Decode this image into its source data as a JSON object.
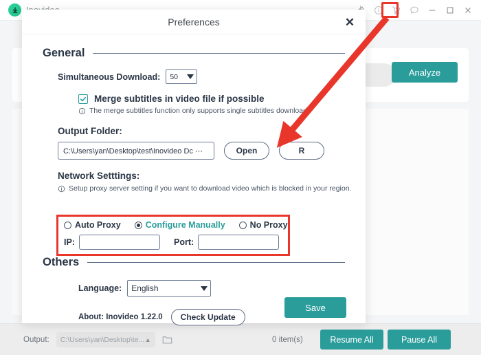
{
  "app": {
    "brand_name": "Inovideo",
    "logo_icon": "download-circle-icon",
    "titlebar_icons": [
      "gear-icon",
      "info-icon",
      "cart-icon",
      "chat-icon",
      "minimize-icon",
      "maximize-icon",
      "close-icon"
    ],
    "url_placeholder": "",
    "analyze_label": "Analyze",
    "accent_color": "#2a9d9b",
    "annotation_color": "#e8362a"
  },
  "statusbar": {
    "output_label": "Output:",
    "output_path": "C:\\Users\\yan\\Desktop\\te...",
    "caret_glyph": "▲",
    "folder_icon": "folder-icon",
    "item_count": "0 item(s)",
    "resume_label": "Resume All",
    "pause_label": "Pause All"
  },
  "modal": {
    "title": "Preferences",
    "close_glyph": "✕",
    "general": {
      "section_title": "General",
      "simultaneous_label": "Simultaneous Download:",
      "simultaneous_value": "50",
      "merge_label": "Merge subtitles in video file if possible",
      "merge_checked": true,
      "merge_hint": "The merge subtitles function only supports single subtitles download",
      "output_folder_label": "Output Folder:",
      "output_folder_path": "C:\\Users\\yan\\Desktop\\test\\Inovideo Dc ⋯",
      "open_label": "Open",
      "reset_label": "R"
    },
    "network": {
      "group_title": "Network Setttings:",
      "hint": "Setup proxy server setting if you want to download video which is blocked in your region.",
      "options": [
        {
          "label": "Auto Proxy",
          "selected": false
        },
        {
          "label": "Configure Manually",
          "selected": true
        },
        {
          "label": "No Proxy",
          "selected": false
        }
      ],
      "ip_label": "IP:",
      "ip_value": "",
      "port_label": "Port:",
      "port_value": ""
    },
    "others": {
      "section_title": "Others",
      "language_label": "Language:",
      "language_value": "English",
      "about_text": "About: Inovideo 1.22.0",
      "check_update_label": "Check Update"
    },
    "save_label": "Save"
  }
}
